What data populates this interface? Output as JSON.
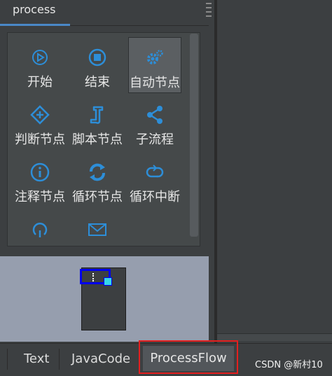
{
  "panel": {
    "tab_label": "process"
  },
  "colors": {
    "accent": "#4a88c7",
    "icon": "#2d8ed8",
    "highlight": "#e41f1f",
    "viewport": "#0000ee",
    "handle": "#36d6e8"
  },
  "tools": [
    {
      "label": "开始",
      "icon": "play-circle-icon"
    },
    {
      "label": "结束",
      "icon": "stop-circle-icon"
    },
    {
      "label": "自动节点",
      "icon": "gears-icon",
      "selected": true
    },
    {
      "label": "判断节点",
      "icon": "diamond-plus-icon"
    },
    {
      "label": "脚本节点",
      "icon": "script-icon"
    },
    {
      "label": "子流程",
      "icon": "share-icon"
    },
    {
      "label": "注释节点",
      "icon": "info-circle-icon"
    },
    {
      "label": "循环节点",
      "icon": "refresh-icon"
    },
    {
      "label": "循环中断",
      "icon": "loop-icon"
    },
    {
      "label": "",
      "icon": "undo-icon"
    },
    {
      "label": "",
      "icon": "envelope-icon"
    }
  ],
  "bottom_tabs": {
    "text": "Text",
    "javacode": "JavaCode",
    "processflow": "ProcessFlow"
  },
  "watermark": "CSDN @新村10"
}
